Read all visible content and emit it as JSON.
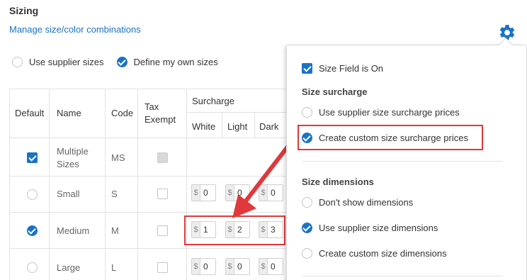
{
  "section": {
    "title": "Sizing",
    "manage_link": "Manage size/color combinations"
  },
  "size_source": {
    "options": [
      {
        "label": "Use supplier sizes",
        "checked": false
      },
      {
        "label": "Define my own sizes",
        "checked": true
      }
    ]
  },
  "table": {
    "headers": {
      "default": "Default",
      "name": "Name",
      "code": "Code",
      "tax_line1": "Tax",
      "tax_line2": "Exempt",
      "surcharge": "Surcharge",
      "white": "White",
      "light": "Light",
      "dark": "Dark"
    },
    "rows": [
      {
        "name_line1": "Multiple",
        "name_line2": "Sizes",
        "code": "MS",
        "default": "checkbox-checked",
        "tax_exempt": "disabled"
      },
      {
        "name": "Small",
        "code": "S",
        "default": "radio",
        "tax_exempt": "unchecked",
        "currency": "$",
        "white": "0",
        "light": "0",
        "dark": "0"
      },
      {
        "name": "Medium",
        "code": "M",
        "default": "radio-checked",
        "tax_exempt": "unchecked",
        "currency": "$",
        "white": "1",
        "light": "2",
        "dark": "3"
      },
      {
        "name": "Large",
        "code": "L",
        "default": "radio",
        "tax_exempt": "unchecked",
        "currency": "$",
        "white": "0",
        "light": "0",
        "dark": "0"
      }
    ]
  },
  "popover": {
    "size_field_label": "Size Field is On",
    "size_field_checked": true,
    "surcharge_heading": "Size surcharge",
    "surcharge_options": [
      {
        "label": "Use supplier size surcharge prices",
        "checked": false
      },
      {
        "label": "Create custom size surcharge prices",
        "checked": true
      }
    ],
    "dimensions_heading": "Size dimensions",
    "dimension_options": [
      {
        "label": "Don't show dimensions",
        "checked": false
      },
      {
        "label": "Use supplier size dimensions",
        "checked": true
      },
      {
        "label": "Create custom size dimensions",
        "checked": false
      }
    ]
  },
  "colors": {
    "accent": "#1a73c7",
    "highlight": "#e0383b"
  },
  "icons": {
    "settings": "gear-icon",
    "annotation": "arrow-icon"
  }
}
